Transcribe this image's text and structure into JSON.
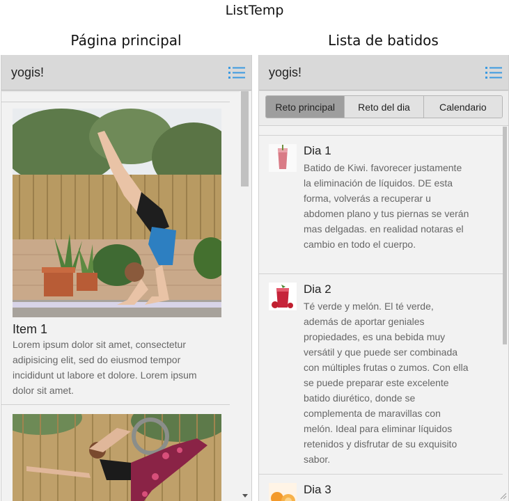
{
  "page": {
    "title": "ListTemp"
  },
  "left": {
    "pane_label": "Página principal",
    "appbar": {
      "brand": "yogis!",
      "menu_icon": "list-menu-icon"
    },
    "items": [
      {
        "title": "Item 1",
        "text": "Lorem ipsum dolor sit amet, consectetur adipisicing elit, sed do eiusmod tempor incididunt ut labore et dolore. Lorem ipsum dolor sit amet."
      }
    ]
  },
  "right": {
    "pane_label": "Lista de batidos",
    "appbar": {
      "brand": "yogis!",
      "menu_icon": "list-menu-icon"
    },
    "tabs": [
      {
        "label": "Reto principal",
        "active": true
      },
      {
        "label": "Reto del dia",
        "active": false
      },
      {
        "label": "Calendario",
        "active": false
      }
    ],
    "items": [
      {
        "title": "Dia 1",
        "text": "Batido de Kiwi. favorecer justamente la eliminación de líquidos. DE esta forma, volverás a recuperar u abdomen plano y tus piernas se verán mas delgadas. en realidad notaras el cambio en todo el cuerpo."
      },
      {
        "title": "Dia 2",
        "text": "Té verde y melón. El té verde, además de aportar geniales propiedades, es una bebida muy versátil y que puede ser combinada con múltiples frutas o zumos. Con ella se puede preparar este excelente batido diurético, donde se complementa de maravillas con melón. Ideal para eliminar líquidos retenidos y disfrutar de su exquisito sabor."
      },
      {
        "title": "Dia 3",
        "text": ""
      }
    ]
  },
  "colors": {
    "accent": "#3b9ae1",
    "appbar": "#d9d9d9",
    "tab_active": "#9e9e9e"
  }
}
